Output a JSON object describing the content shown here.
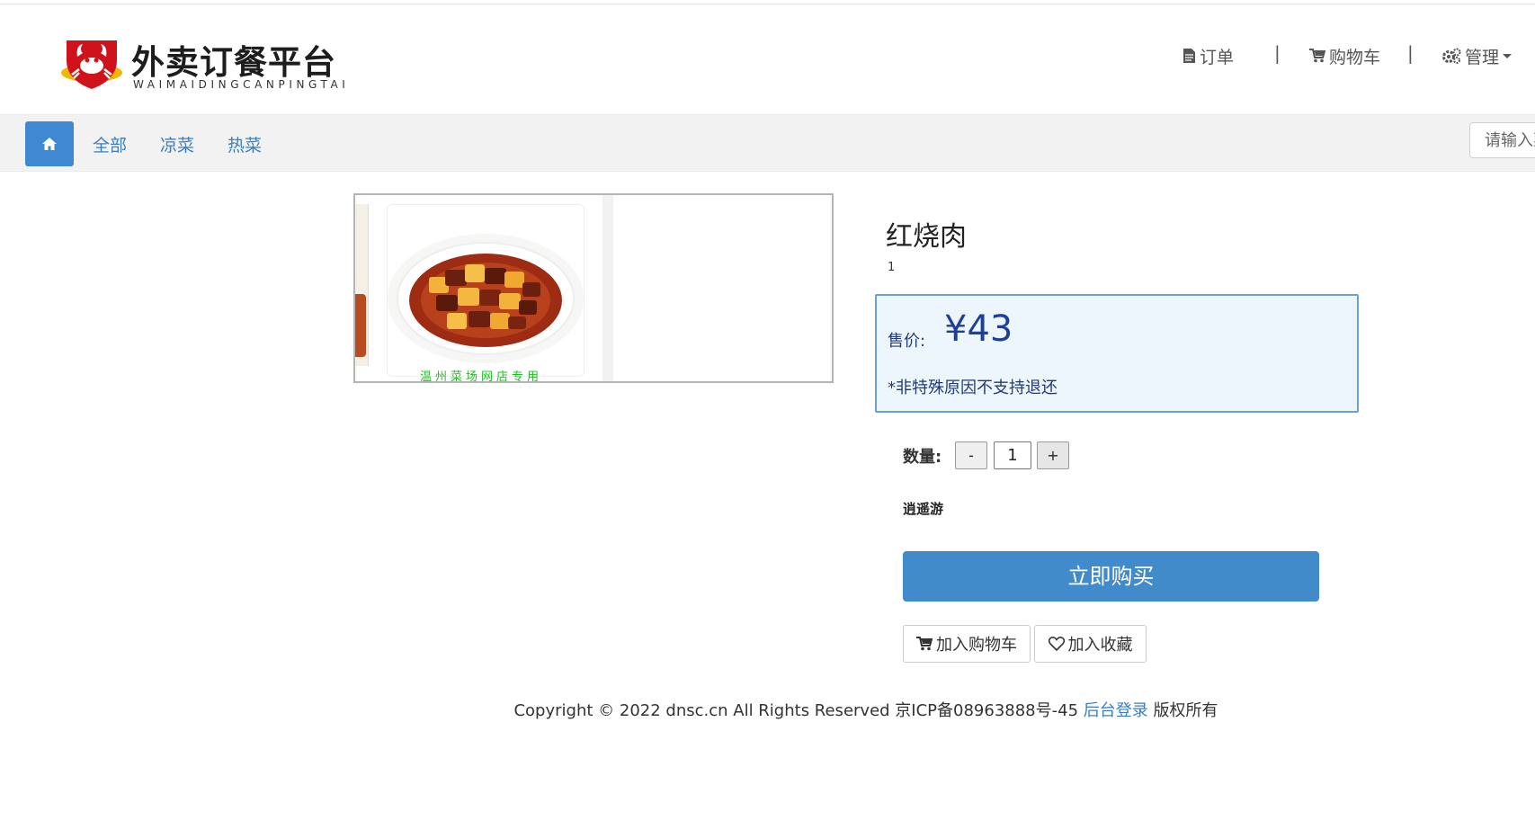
{
  "brand": {
    "title": "外卖订餐平台",
    "subtitle": "WAIMAIDINGCANPINGTAI"
  },
  "topnav": {
    "orders": "订单",
    "cart": "购物车",
    "admin": "管理",
    "separator": "|"
  },
  "categories": {
    "items": [
      "全部",
      "凉菜",
      "热菜"
    ]
  },
  "search": {
    "placeholder": "请输入菜"
  },
  "product": {
    "image_watermark": "温州菜场网店专用",
    "name": "红烧肉",
    "subtitle": "1",
    "price_label": "售价:",
    "price": "¥43",
    "notice": "*非特殊原因不支持退还",
    "quantity_label": "数量:",
    "quantity": "1",
    "decrement": "-",
    "increment": "+",
    "store": "逍遥游",
    "buy_now": "立即购买",
    "add_to_cart": "加入购物车",
    "add_to_favorites": "加入收藏"
  },
  "footer": {
    "copyright": "Copyright © 2022 dnsc.cn All Rights Reserved 京ICP备08963888号-45",
    "admin_login": "后台登录",
    "rights": "版权所有"
  },
  "colors": {
    "primary": "#428bca",
    "link": "#3b7ec0",
    "price": "#1c3f9a",
    "price_box_bg": "#edf5fd"
  },
  "icons": {
    "home": "home-icon",
    "orders": "document-icon",
    "cart": "cart-icon",
    "admin": "gears-icon",
    "favorite": "heart-icon"
  }
}
